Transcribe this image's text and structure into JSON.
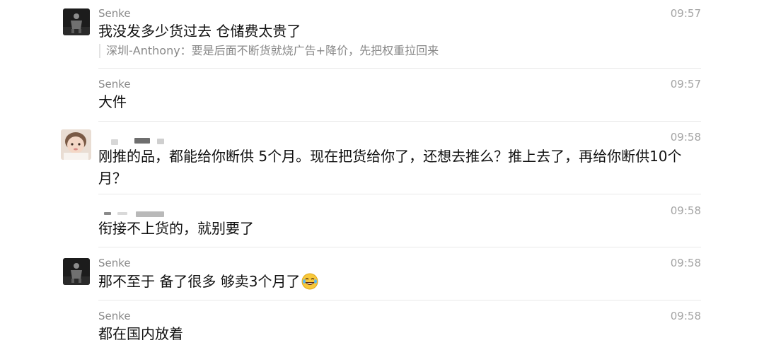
{
  "messages": [
    {
      "sender": "Senke",
      "time": "09:57",
      "text": "我没发多少货过去 仓储费太贵了",
      "quote": "深圳-Anthony：要是后面不断货就烧广告+降价，先把权重拉回来",
      "avatar_icon": "dark-figure-avatar-icon"
    },
    {
      "sender": "Senke",
      "time": "09:57",
      "text": "大件"
    },
    {
      "sender": "",
      "time": "09:58",
      "text": "刚推的品，都能给你断供 5个月。现在把货给你了，还想去推么？推上去了，再给你断供10个月？",
      "avatar_icon": "baby-photo-avatar-icon"
    },
    {
      "sender": "",
      "time": "09:58",
      "text": "衔接不上货的，就别要了"
    },
    {
      "sender": "Senke",
      "time": "09:58",
      "text": "那不至于 备了很多 够卖3个月了",
      "emoji": "laughing-tears-emoji",
      "avatar_icon": "dark-figure-avatar-icon"
    },
    {
      "sender": "Senke",
      "time": "09:58",
      "text": "都在国内放着"
    }
  ],
  "colors": {
    "sender": "#8a8a8a",
    "time": "#a4a4a4",
    "text": "#111111",
    "divider": "#e9e9e9"
  }
}
